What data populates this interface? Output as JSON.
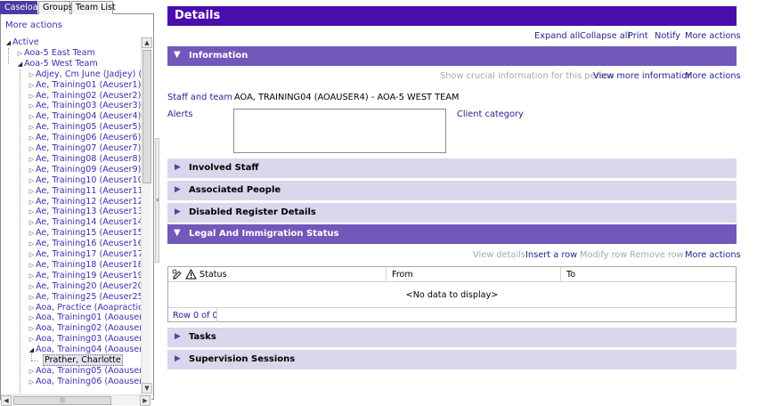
{
  "left_tabs": [
    "Caseload",
    "Groups",
    "Team List"
  ],
  "left_more_actions": "More actions",
  "tree": [
    {
      "label": "Active",
      "level": 0,
      "expander": "open"
    },
    {
      "label": "Aoa-5 East Team",
      "level": 1,
      "expander": "closed"
    },
    {
      "label": "Aoa-5 West Team",
      "level": 1,
      "expander": "open"
    },
    {
      "label": "Adjey, Cm June (Jadjey) (1)",
      "level": 2,
      "expander": "closed"
    },
    {
      "label": "Ae, Training01 (Aeuser1) (0",
      "level": 2,
      "expander": "closed"
    },
    {
      "label": "Ae, Training02 (Aeuser2) (7",
      "level": 2,
      "expander": "closed"
    },
    {
      "label": "Ae, Training03 (Aeuser3) (9",
      "level": 2,
      "expander": "closed"
    },
    {
      "label": "Ae, Training04 (Aeuser4) (1",
      "level": 2,
      "expander": "closed"
    },
    {
      "label": "Ae, Training05 (Aeuser5) (9",
      "level": 2,
      "expander": "closed"
    },
    {
      "label": "Ae, Training06 (Aeuser6) (5",
      "level": 2,
      "expander": "closed"
    },
    {
      "label": "Ae, Training07 (Aeuser7) (7",
      "level": 2,
      "expander": "closed"
    },
    {
      "label": "Ae, Training08 (Aeuser8) (5",
      "level": 2,
      "expander": "closed"
    },
    {
      "label": "Ae, Training09 (Aeuser9) (5",
      "level": 2,
      "expander": "closed"
    },
    {
      "label": "Ae, Training10 (Aeuser10) (",
      "level": 2,
      "expander": "closed"
    },
    {
      "label": "Ae, Training11 (Aeuser11) (",
      "level": 2,
      "expander": "closed"
    },
    {
      "label": "Ae, Training12 (Aeuser12) (",
      "level": 2,
      "expander": "closed"
    },
    {
      "label": "Ae, Training13 (Aeuser13) (",
      "level": 2,
      "expander": "closed"
    },
    {
      "label": "Ae, Training14 (Aeuser14) (",
      "level": 2,
      "expander": "closed"
    },
    {
      "label": "Ae, Training15 (Aeuser15) (",
      "level": 2,
      "expander": "closed"
    },
    {
      "label": "Ae, Training16 (Aeuser16) (",
      "level": 2,
      "expander": "closed"
    },
    {
      "label": "Ae, Training17 (Aeuser17) (",
      "level": 2,
      "expander": "closed"
    },
    {
      "label": "Ae, Training18 (Aeuser18) (",
      "level": 2,
      "expander": "closed"
    },
    {
      "label": "Ae, Training19 (Aeuser19) (",
      "level": 2,
      "expander": "closed"
    },
    {
      "label": "Ae, Training20 (Aeuser20) (",
      "level": 2,
      "expander": "closed"
    },
    {
      "label": "Ae, Training25 (Aeuser25) (",
      "level": 2,
      "expander": "closed"
    },
    {
      "label": "Aoa, Practice (Aoapractic) (",
      "level": 2,
      "expander": "closed"
    },
    {
      "label": "Aoa, Training01 (Aoauser1)",
      "level": 2,
      "expander": "closed"
    },
    {
      "label": "Aoa, Training02 (Aoauser2)",
      "level": 2,
      "expander": "closed"
    },
    {
      "label": "Aoa, Training03 (Aoauser3)",
      "level": 2,
      "expander": "closed"
    },
    {
      "label": "Aoa, Training04 (Aoauser4)",
      "level": 2,
      "expander": "open"
    },
    {
      "label": "Prather, Charlotte",
      "level": 3,
      "expander": "none",
      "selected": true
    },
    {
      "label": "Aoa, Training05 (Aoauser5)",
      "level": 2,
      "expander": "closed"
    },
    {
      "label": "Aoa, Training06 (Aoauser6)",
      "level": 2,
      "expander": "closed"
    }
  ],
  "details_title": "Details",
  "top_actions": [
    "Expand all",
    "Collapse all",
    "Print",
    "Notify",
    "More actions"
  ],
  "information": {
    "title": "Information",
    "actions": {
      "show_crucial": "Show crucial information for this person",
      "view_more": "View more information",
      "more_actions": "More actions"
    },
    "staff_label": "Staff and team",
    "staff_value": "AOA, TRAINING04 (AOAUSER4) - AOA-5 WEST TEAM",
    "alerts_label": "Alerts",
    "client_category_label": "Client category"
  },
  "sections": {
    "involved_staff": "Involved Staff",
    "associated_people": "Associated People",
    "disabled_register": "Disabled Register Details",
    "legal": "Legal And Immigration Status",
    "tasks": "Tasks",
    "supervision": "Supervision Sessions"
  },
  "legal_actions": {
    "view_details": "View details",
    "insert_row": "Insert a row",
    "modify_row": "Modify row",
    "remove_row": "Remove row",
    "more_actions": "More actions"
  },
  "legal_grid": {
    "columns": [
      "Status",
      "From",
      "To"
    ],
    "empty_message": "<No data to display>",
    "row_count": "Row 0 of 0"
  },
  "colors": {
    "header": "#4b0cad",
    "expanded_bar": "#7258ba",
    "collapsed_bar": "#dad6ec",
    "link": "#2a2090",
    "active_tab": "#4e3aa3"
  }
}
